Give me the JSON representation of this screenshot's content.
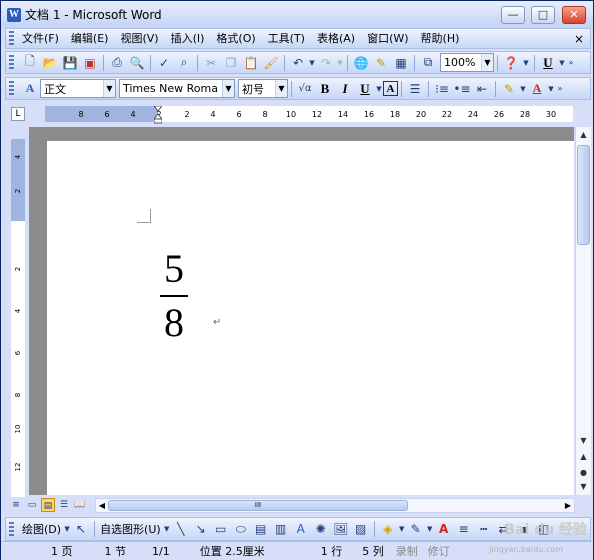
{
  "window": {
    "title": "文档 1 - Microsoft Word",
    "app_icon": "W",
    "controls": {
      "minimize": "—",
      "maximize": "□",
      "close": "✕"
    }
  },
  "menubar": {
    "items": [
      "文件(F)",
      "编辑(E)",
      "视图(V)",
      "插入(I)",
      "格式(O)",
      "工具(T)",
      "表格(A)",
      "窗口(W)",
      "帮助(H)"
    ],
    "close_doc": "×"
  },
  "standard_toolbar": {
    "icons": [
      "new-icon",
      "open-icon",
      "save-icon",
      "permission-icon",
      "print-icon",
      "print-preview-icon",
      "spelling-icon",
      "research-icon",
      "cut-icon",
      "copy-icon",
      "paste-icon",
      "format-painter-icon",
      "undo-icon",
      "redo-icon",
      "hyperlink-icon",
      "tables-borders-icon",
      "insert-table-icon",
      "drawing-icon",
      "zoom-icon",
      "help-icon"
    ],
    "zoom_value": "100%"
  },
  "formatting_toolbar": {
    "style_value": "正文",
    "font_value": "Times New Roma",
    "size_value": "初号",
    "bold": "B",
    "italic": "I",
    "underline": "U",
    "char_border": "A"
  },
  "ruler": {
    "h_ticks": [
      "8",
      "6",
      "4",
      "2",
      "2",
      "4",
      "6",
      "8",
      "10",
      "12",
      "14",
      "16",
      "18",
      "20",
      "22",
      "24",
      "26",
      "28",
      "30"
    ],
    "v_ticks": [
      "4",
      "2",
      "2",
      "4",
      "6",
      "8",
      "10",
      "12"
    ]
  },
  "document": {
    "numerator": "5",
    "denominator": "8",
    "paragraph_mark": "↵"
  },
  "hscroll_thumb": "III",
  "drawing_toolbar": {
    "draw_label": "绘图(D)",
    "autoshapes_label": "自选图形(U)"
  },
  "statusbar": {
    "page": "1 页",
    "section": "1 节",
    "page_of": "1/1",
    "position": "位置 2.5厘米",
    "line": "1 行",
    "column": "5 列",
    "rec": "录制",
    "trk": "修订"
  },
  "watermark": "Bai du 经验",
  "watermark_url": "jingyan.baidu.com"
}
